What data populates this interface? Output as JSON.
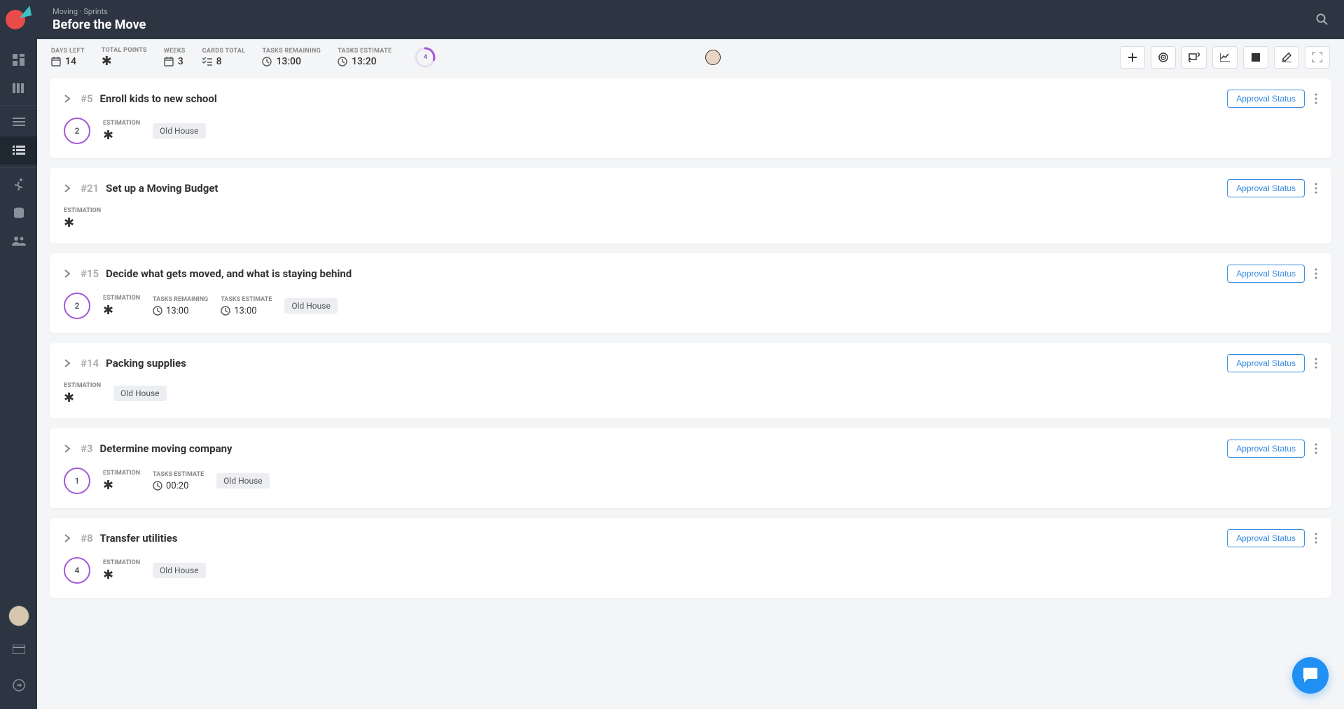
{
  "breadcrumb": "Moving · Sprints",
  "page_title": "Before the Move",
  "stats": {
    "days_left": {
      "label": "DAYS LEFT",
      "value": "14"
    },
    "total_points": {
      "label": "TOTAL POINTS",
      "value": ""
    },
    "weeks": {
      "label": "WEEKS",
      "value": "3"
    },
    "cards_total": {
      "label": "CARDS TOTAL",
      "value": "8"
    },
    "tasks_remaining": {
      "label": "TASKS REMAINING",
      "value": "13:00"
    },
    "tasks_estimate": {
      "label": "TASKS ESTIMATE",
      "value": "13:20"
    },
    "progress": "4"
  },
  "approval_label": "Approval Status",
  "mini_labels": {
    "estimation": "ESTIMATION",
    "tasks_remaining": "TASKS REMAINING",
    "tasks_estimate": "TASKS ESTIMATE"
  },
  "tags": {
    "old_house": "Old House"
  },
  "cards": [
    {
      "id": "#5",
      "title": "Enroll kids to new school",
      "progress": "2",
      "has_progress": true,
      "stats": [
        "estimation"
      ],
      "tag": "old_house"
    },
    {
      "id": "#21",
      "title": "Set up a Moving Budget",
      "has_progress": false,
      "stats": [
        "estimation"
      ],
      "tag": null
    },
    {
      "id": "#15",
      "title": "Decide what gets moved, and what is staying behind",
      "progress": "2",
      "has_progress": true,
      "stats": [
        "estimation",
        "tasks_remaining",
        "tasks_estimate"
      ],
      "tasks_remaining": "13:00",
      "tasks_estimate": "13:00",
      "tag": "old_house"
    },
    {
      "id": "#14",
      "title": "Packing supplies",
      "has_progress": false,
      "stats": [
        "estimation"
      ],
      "tag": "old_house"
    },
    {
      "id": "#3",
      "title": "Determine moving company",
      "progress": "1",
      "has_progress": true,
      "stats": [
        "estimation",
        "tasks_estimate"
      ],
      "tasks_estimate": "00:20",
      "tag": "old_house"
    },
    {
      "id": "#8",
      "title": "Transfer utilities",
      "progress": "4",
      "has_progress": true,
      "stats": [
        "estimation"
      ],
      "tag": "old_house"
    }
  ]
}
